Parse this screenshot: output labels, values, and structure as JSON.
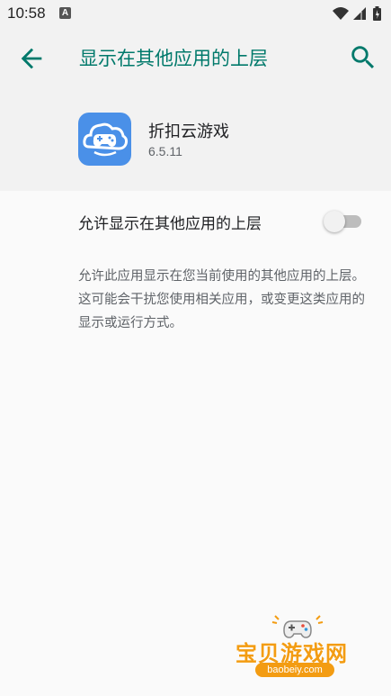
{
  "status_bar": {
    "time": "10:58",
    "notification_badge": "A",
    "icons": [
      "wifi-icon",
      "signal-icon",
      "battery-icon"
    ]
  },
  "app_bar": {
    "title": "显示在其他应用的上层",
    "back_icon": "arrow-back-icon",
    "search_icon": "search-icon",
    "accent_color": "#00796b"
  },
  "app_info": {
    "name": "折扣云游戏",
    "version": "6.5.11",
    "icon": "cloud-gamepad-icon",
    "icon_color": "#4a90e8"
  },
  "setting": {
    "label": "允许显示在其他应用的上层",
    "enabled": false
  },
  "description": "允许此应用显示在您当前使用的其他应用的上层。这可能会干扰您使用相关应用，或变更这类应用的显示或运行方式。",
  "watermark": {
    "text": "宝贝游戏网",
    "url": "baobeiy.com"
  }
}
